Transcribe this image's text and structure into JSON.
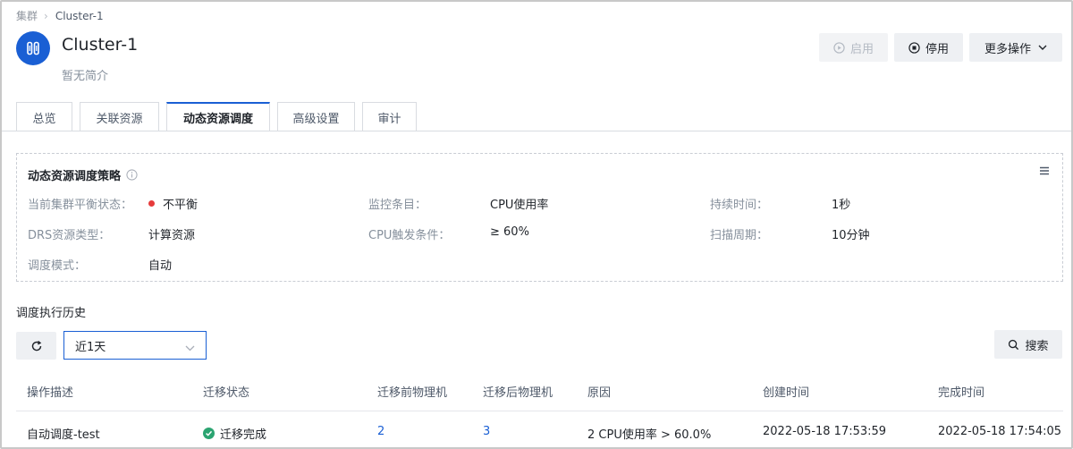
{
  "breadcrumb": {
    "root": "集群",
    "current": "Cluster-1"
  },
  "header": {
    "title": "Cluster-1",
    "subtitle": "暂无简介",
    "start_label": "启用",
    "stop_label": "停用",
    "more_label": "更多操作"
  },
  "tabs": [
    {
      "label": "总览",
      "active": false
    },
    {
      "label": "关联资源",
      "active": false
    },
    {
      "label": "动态资源调度",
      "active": true
    },
    {
      "label": "高级设置",
      "active": false
    },
    {
      "label": "审计",
      "active": false
    }
  ],
  "policy": {
    "title": "动态资源调度策略",
    "fields": {
      "balance_label": "当前集群平衡状态：",
      "balance_value": "不平衡",
      "metric_label": "监控条目：",
      "metric_value": "CPU使用率",
      "duration_label": "持续时间：",
      "duration_value": "1秒",
      "drs_type_label": "DRS资源类型：",
      "drs_type_value": "计算资源",
      "trigger_label": "CPU触发条件：",
      "trigger_value": "≥ 60%",
      "period_label": "扫描周期：",
      "period_value": "10分钟",
      "mode_label": "调度模式：",
      "mode_value": "自动"
    }
  },
  "history": {
    "title": "调度执行历史",
    "range_value": "近1天",
    "search_label": "搜索",
    "columns": [
      "操作描述",
      "迁移状态",
      "迁移前物理机",
      "迁移后物理机",
      "原因",
      "创建时间",
      "完成时间"
    ],
    "rows": [
      {
        "desc": "自动调度-test",
        "status": "迁移完成",
        "before_host": "2",
        "after_host": "3",
        "reason": "2 CPU使用率 > 60.0%",
        "created": "2022-05-18 17:53:59",
        "finished": "2022-05-18 17:54:05"
      }
    ]
  },
  "colors": {
    "accent": "#1a5fd4",
    "success": "#2ba471",
    "danger": "#e63b3b"
  },
  "icons": [
    "cluster-icon",
    "play-circle-icon",
    "stop-circle-icon",
    "chevron-down-icon",
    "info-icon",
    "menu-icon",
    "refresh-icon",
    "search-icon",
    "check-circle-icon"
  ]
}
